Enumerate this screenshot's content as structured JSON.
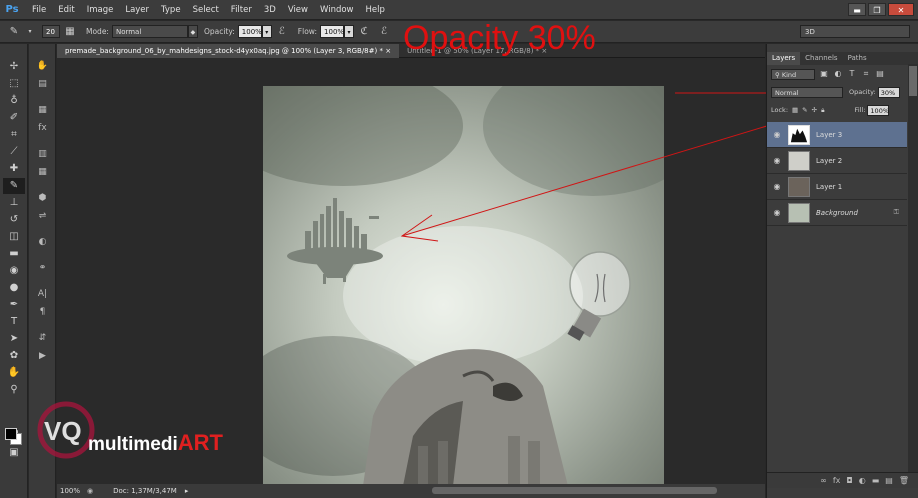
{
  "menu": {
    "logo": "Ps",
    "items": [
      "File",
      "Edit",
      "Image",
      "Layer",
      "Type",
      "Select",
      "Filter",
      "3D",
      "View",
      "Window",
      "Help"
    ]
  },
  "window_controls": {
    "minimize": "▬",
    "restore": "❐",
    "close": "✕"
  },
  "options": {
    "brush_size": "20",
    "mode_label": "Mode:",
    "mode_value": "Normal",
    "opacity_label": "Opacity:",
    "opacity_value": "100%",
    "flow_label": "Flow:",
    "flow_value": "100%",
    "workspace": "3D"
  },
  "tabs": [
    {
      "label": "premade_background_06_by_mahdesigns_stock-d4yx0aq.jpg @ 100% (Layer 3, RGB/8#) *"
    },
    {
      "label": "Untitled-1 @ 50% (Layer 17, RGB/8) *"
    }
  ],
  "annotation": {
    "text": "Opacity 30%",
    "color": "#e01010"
  },
  "status": {
    "zoom": "100%",
    "doc": "Doc: 1,37M/3,47M"
  },
  "watermark": {
    "prefix": "VQ",
    "word": "multimedi",
    "accent": "ART"
  },
  "layers_panel": {
    "tabs": [
      "Layers",
      "Channels",
      "Paths"
    ],
    "kind_label": "Kind",
    "blend_mode": "Normal",
    "opacity_label": "Opacity:",
    "opacity_value": "30%",
    "lock_label": "Lock:",
    "fill_label": "Fill:",
    "fill_value": "100%",
    "layers": [
      {
        "name": "Layer 3",
        "selected": true
      },
      {
        "name": "Layer 2",
        "selected": false
      },
      {
        "name": "Layer 1",
        "selected": false
      },
      {
        "name": "Background",
        "selected": false,
        "locked": true
      }
    ]
  }
}
